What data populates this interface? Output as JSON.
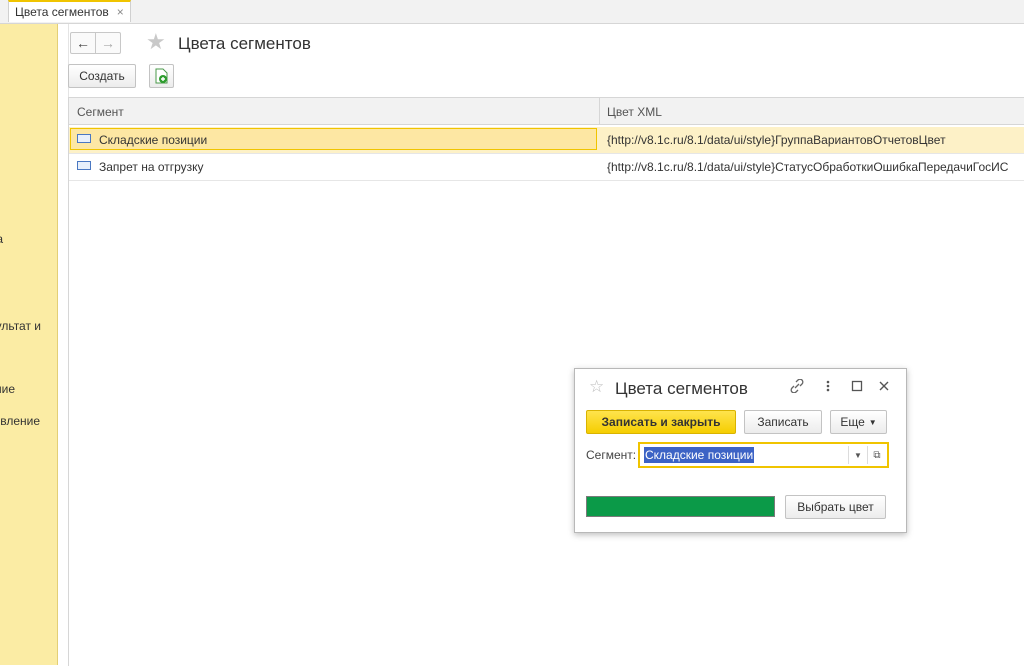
{
  "tab": {
    "label": "Цвета сегментов",
    "close": "×"
  },
  "sidebar": {
    "items": [
      "а",
      "ультат и",
      "ние",
      "вление"
    ]
  },
  "header": {
    "title": "Цвета сегментов",
    "back": "←",
    "forward": "→",
    "star": "★"
  },
  "toolbar": {
    "create": "Создать",
    "add_icon": "add-document-icon"
  },
  "table": {
    "columns": [
      "Сегмент",
      "Цвет XML"
    ],
    "rows": [
      {
        "segment": "Складские позиции",
        "color_xml": "{http://v8.1c.ru/8.1/data/ui/style}ГруппаВариантовОтчетовЦвет",
        "selected": true
      },
      {
        "segment": "Запрет на отгрузку",
        "color_xml": "{http://v8.1c.ru/8.1/data/ui/style}СтатусОбработкиОшибкаПередачиГосИС",
        "selected": false
      }
    ]
  },
  "dialog": {
    "star": "☆",
    "title": "Цвета сегментов",
    "icons": [
      "link-icon",
      "more-vertical-icon",
      "maximize-icon",
      "close-icon"
    ],
    "save_close": "Записать и закрыть",
    "save": "Записать",
    "more": "Еще",
    "segment_label": "Сегмент:",
    "segment_value": "Складские позиции",
    "swatch_color": "#0b9a48",
    "pick_color": "Выбрать цвет"
  },
  "colors": {
    "accent": "#f0c400",
    "sidebar": "#fbeca4",
    "selected_row": "#fde7a3"
  }
}
